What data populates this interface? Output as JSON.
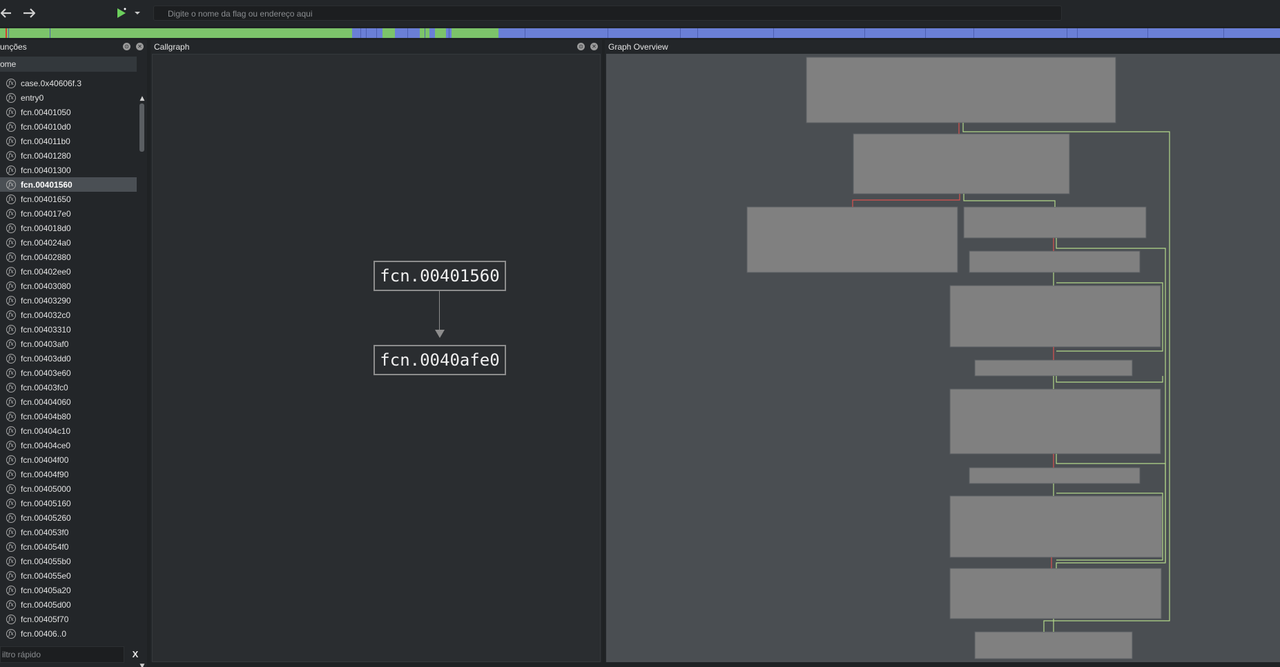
{
  "toolbar": {
    "back_icon": "arrow-left-icon",
    "forward_icon": "arrow-right-icon",
    "run_icon": "play-icon",
    "run_dropdown_icon": "caret-down-icon",
    "search_placeholder": "Digite o nome da flag ou endereço aqui",
    "run_color": "#6ccf5c"
  },
  "navbar": {
    "code_color": "#7cc36a",
    "data_color": "#6a7fd6",
    "marker_color": "#d2402f"
  },
  "functions": {
    "title": "unções",
    "column_header": "ome",
    "items": [
      "case.0x40606f.3",
      "entry0",
      "fcn.00401050",
      "fcn.004010d0",
      "fcn.004011b0",
      "fcn.00401280",
      "fcn.00401300",
      "fcn.00401560",
      "fcn.00401650",
      "fcn.004017e0",
      "fcn.004018d0",
      "fcn.004024a0",
      "fcn.00402880",
      "fcn.00402ee0",
      "fcn.00403080",
      "fcn.00403290",
      "fcn.004032c0",
      "fcn.00403310",
      "fcn.00403af0",
      "fcn.00403dd0",
      "fcn.00403e60",
      "fcn.00403fc0",
      "fcn.00404060",
      "fcn.00404b80",
      "fcn.00404c10",
      "fcn.00404ce0",
      "fcn.00404f00",
      "fcn.00404f90",
      "fcn.00405000",
      "fcn.00405160",
      "fcn.00405260",
      "fcn.004053f0",
      "fcn.004054f0",
      "fcn.004055b0",
      "fcn.004055e0",
      "fcn.00405a20",
      "fcn.00405d00",
      "fcn.00405f70",
      "fcn.00406..0"
    ],
    "selected": "fcn.00401560",
    "filter_placeholder": "iltro rápido",
    "filter_clear": "X"
  },
  "callgraph": {
    "title": "Callgraph",
    "source_node": "fcn.00401560",
    "target_node": "fcn.0040afe0"
  },
  "overview": {
    "title": "Graph Overview",
    "block_color": "#808080",
    "true_edge_color": "#b5d98a",
    "false_edge_color": "#d9534f"
  }
}
